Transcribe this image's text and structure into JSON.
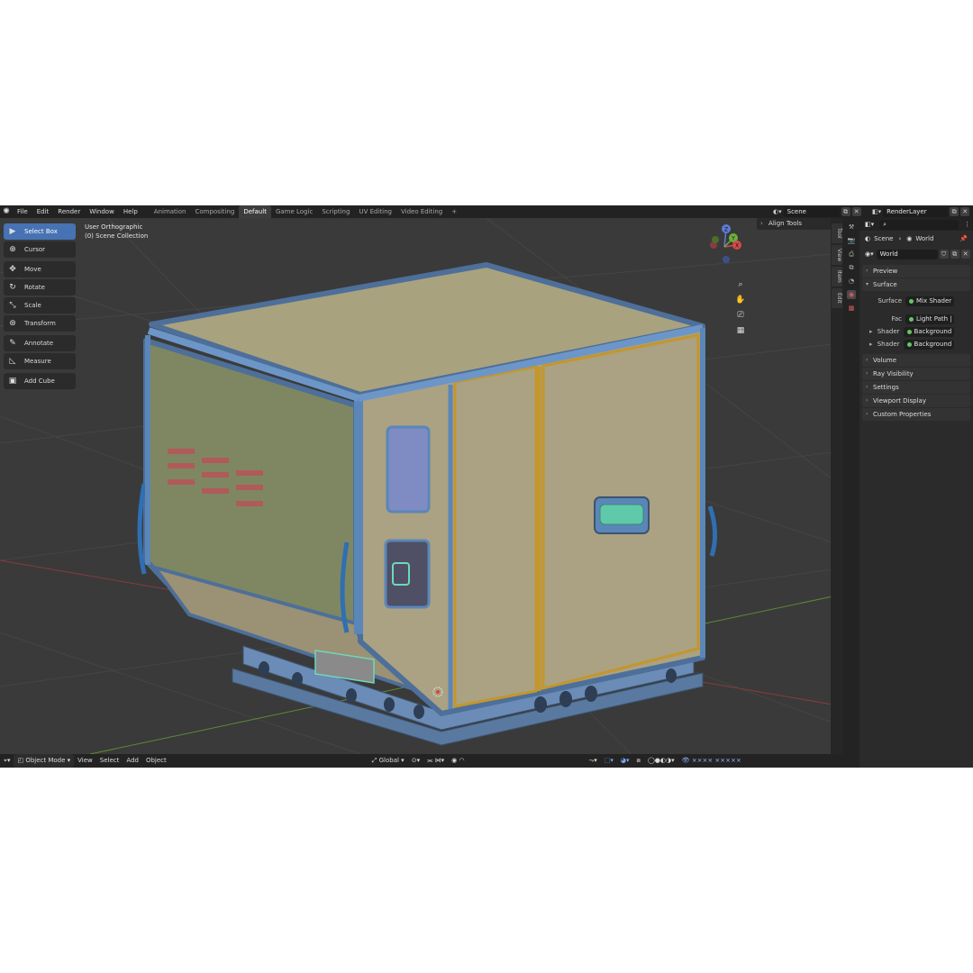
{
  "menu": [
    "File",
    "Edit",
    "Render",
    "Window",
    "Help"
  ],
  "workspaces": [
    "Animation",
    "Compositing",
    "Default",
    "Game Logic",
    "Scripting",
    "UV Editing",
    "Video Editing",
    "+"
  ],
  "active_workspace_index": 2,
  "scene_field": "Scene",
  "renderlayer_field": "RenderLayer",
  "tools": [
    {
      "label": "Select Box",
      "icon": "select-box-icon",
      "glyph": "▶"
    },
    {
      "label": "Cursor",
      "icon": "cursor-icon",
      "glyph": "⊕"
    },
    {
      "label": "Move",
      "icon": "move-icon",
      "glyph": "✥"
    },
    {
      "label": "Rotate",
      "icon": "rotate-icon",
      "glyph": "↻"
    },
    {
      "label": "Scale",
      "icon": "scale-icon",
      "glyph": "⤡"
    },
    {
      "label": "Transform",
      "icon": "transform-icon",
      "glyph": "⊛"
    },
    {
      "label": "Annotate",
      "icon": "annotate-icon",
      "glyph": "✎"
    },
    {
      "label": "Measure",
      "icon": "measure-icon",
      "glyph": "◺"
    },
    {
      "label": "Add Cube",
      "icon": "add-cube-icon",
      "glyph": "▣"
    }
  ],
  "viewport": {
    "view_name": "User Orthographic",
    "collection": "(0) Scene Collection",
    "align_tools": "Align Tools"
  },
  "side_tabs": [
    "Tool",
    "View",
    "Item",
    "Edit"
  ],
  "bottom": {
    "mode": "Object Mode",
    "menus": [
      "View",
      "Select",
      "Add",
      "Object"
    ],
    "transform": "Global"
  },
  "properties": {
    "breadcrumb_scene": "Scene",
    "breadcrumb_world": "World",
    "world_field": "World",
    "sections_top": [
      "Preview"
    ],
    "surface_label": "Surface",
    "surface_rows": [
      {
        "key": "Surface",
        "value": "Mix Shader"
      },
      {
        "key": "Fac",
        "value": "Light Path | I..."
      },
      {
        "key": "Shader",
        "value": "Background"
      },
      {
        "key": "Shader",
        "value": "Background"
      }
    ],
    "sections_bottom": [
      "Volume",
      "Ray Visibility",
      "Settings",
      "Viewport Display",
      "Custom Properties"
    ]
  },
  "gizmo_axes": {
    "z": "Z",
    "y": "Y",
    "x": "X"
  },
  "colors": {
    "accent": "#4772b3",
    "viewport_bg": "#3a3a3a",
    "crate_panel": "#a8a17d",
    "crate_frame": "#5b86b8",
    "crate_trim": "#c4962c"
  }
}
